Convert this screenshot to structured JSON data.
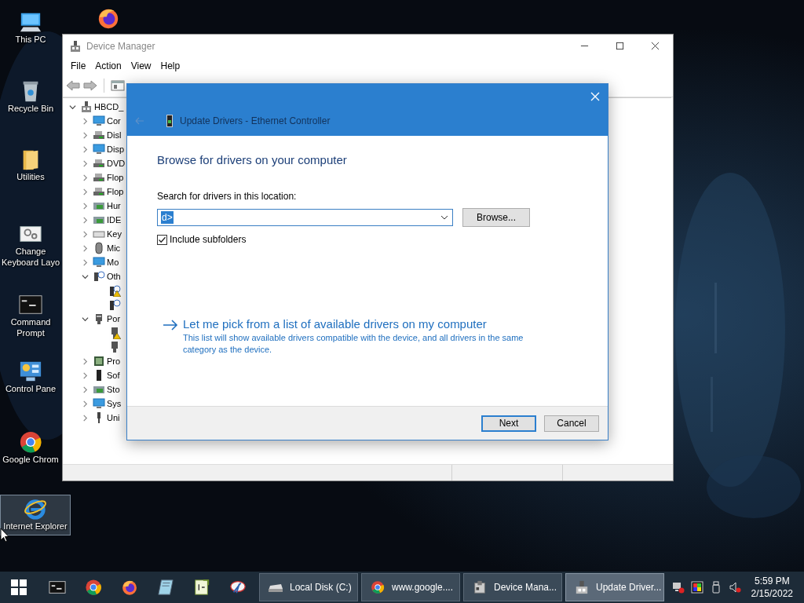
{
  "desktop_icons": [
    {
      "label": "This PC",
      "selected": false
    },
    {
      "label": "Recycle Bin",
      "selected": false
    },
    {
      "label": "Utilities",
      "selected": false
    },
    {
      "label": "Change Keyboard Layo",
      "selected": false
    },
    {
      "label": "Command Prompt",
      "selected": false
    },
    {
      "label": "Control Pane",
      "selected": false
    },
    {
      "label": "Google Chrom",
      "selected": false
    },
    {
      "label": "Internet Explorer",
      "selected": true
    },
    {
      "selected": false
    }
  ],
  "device_manager": {
    "title": "Device Manager",
    "menu": [
      "File",
      "Action",
      "View",
      "Help"
    ],
    "tree": {
      "label": "HBCD_",
      "expanded": true,
      "children": [
        {
          "label": "Cor",
          "expanded": false
        },
        {
          "label": "Disl",
          "expanded": false
        },
        {
          "label": "Disp",
          "expanded": false
        },
        {
          "label": "DVD",
          "expanded": false
        },
        {
          "label": "Flop",
          "expanded": false
        },
        {
          "label": "Flop",
          "expanded": false
        },
        {
          "label": "Hur",
          "expanded": false
        },
        {
          "label": "IDE",
          "expanded": false
        },
        {
          "label": "Key",
          "expanded": false
        },
        {
          "label": "Mic",
          "expanded": false
        },
        {
          "label": "Mo",
          "expanded": false
        },
        {
          "label": "Oth",
          "expanded": true,
          "children": [
            {
              "warning": true
            },
            {
              "warning": false
            }
          ]
        },
        {
          "label": "Por",
          "expanded": true,
          "children": [
            {
              "warning": true
            },
            {
              "warning": false
            }
          ]
        },
        {
          "label": "Pro",
          "expanded": false
        },
        {
          "label": "Sof",
          "expanded": false
        },
        {
          "label": "Sto",
          "expanded": false
        },
        {
          "label": "Sys",
          "expanded": false
        },
        {
          "label": "Uni",
          "expanded": false
        }
      ]
    }
  },
  "dialog": {
    "title": "Update Drivers - Ethernet Controller",
    "heading": "Browse for drivers on your computer",
    "location_label": "Search for drivers in this location:",
    "location_value": "d>",
    "browse_button": "Browse...",
    "include_subfolders": {
      "label": "Include subfolders",
      "checked": true
    },
    "pick_link": "Let me pick from a list of available drivers on my computer",
    "pick_description": "This list will show available drivers compatible with the device, and all drivers in the same category as the device.",
    "buttons": [
      {
        "label": "Next",
        "default": true
      },
      {
        "label": "Cancel",
        "default": false
      }
    ]
  },
  "taskbar": {
    "tasks": [
      {
        "label": "Local Disk (C:)",
        "selected": false
      },
      {
        "label": "www.google....",
        "selected": false
      },
      {
        "label": "Device Mana...",
        "selected": false
      },
      {
        "label": "Update Driver...",
        "selected": true
      }
    ],
    "clock": {
      "time": "5:59 PM",
      "date": "2/15/2022"
    }
  }
}
